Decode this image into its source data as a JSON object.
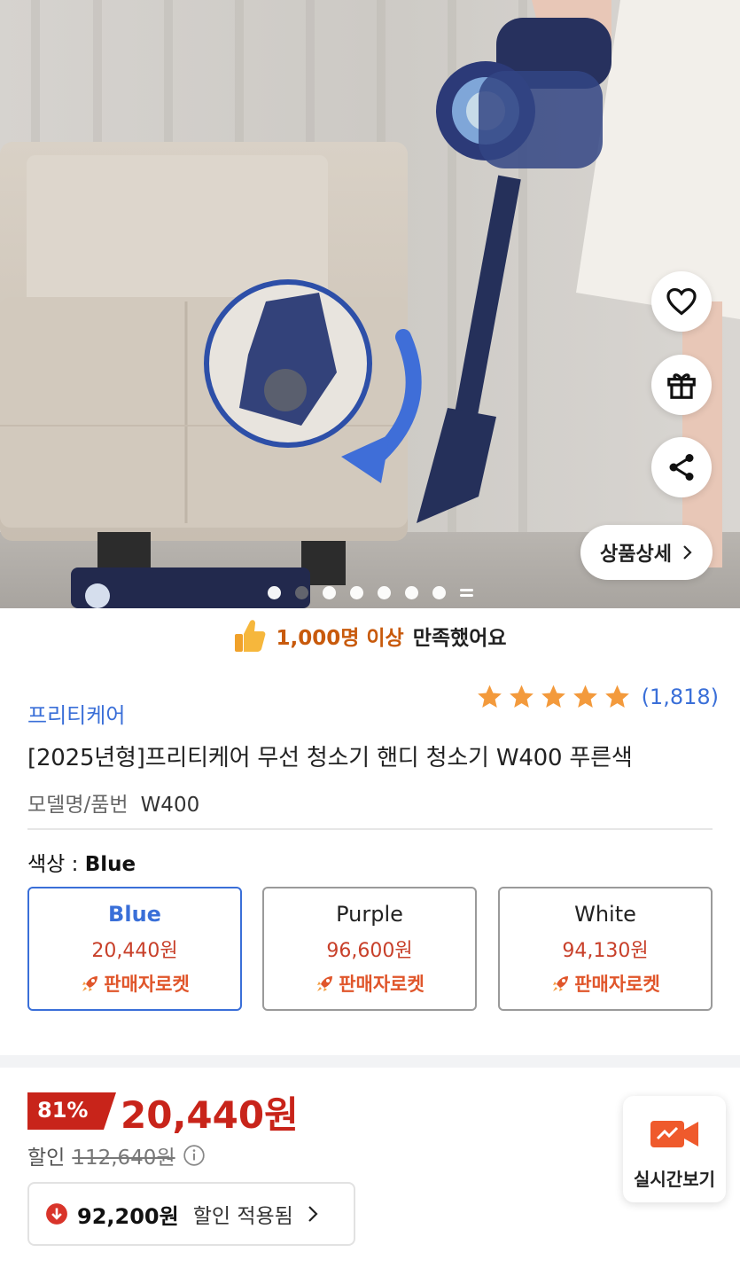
{
  "hero": {
    "detail_button": "상품상세",
    "carousel_total": 7,
    "carousel_active": 2
  },
  "satisfied": {
    "count_text": "1,000명 이상",
    "suffix": "만족했어요"
  },
  "product": {
    "brand": "프리티케어",
    "rating_stars": 5,
    "review_count": "(1,818)",
    "title": "[2025년형]프리티케어 무선 청소기 핸디 청소기 W400 푸른색",
    "model_label": "모델명/품번",
    "model_value": "W400"
  },
  "color": {
    "label": "색상 :",
    "selected": "Blue",
    "options": [
      {
        "name": "Blue",
        "price": "20,440원",
        "badge": "판매자로켓"
      },
      {
        "name": "Purple",
        "price": "96,600원",
        "badge": "판매자로켓"
      },
      {
        "name": "White",
        "price": "94,130원",
        "badge": "판매자로켓"
      }
    ]
  },
  "price": {
    "discount_rate": "81%",
    "final": "20,440원",
    "discount_label": "할인",
    "original": "112,640원",
    "coupon_amount": "92,200원",
    "coupon_label": "할인 적용됨"
  },
  "live": {
    "label": "실시간보기"
  },
  "colors": {
    "brand_blue": "#3a6fd8",
    "price_red": "#c8241a",
    "rocket_orange": "#e0562b",
    "star_orange": "#f39a3c"
  },
  "icons": [
    "heart-icon",
    "gift-icon",
    "share-icon",
    "chevron-right-icon",
    "thumbs-up-icon",
    "star-icon",
    "rocket-icon",
    "info-icon",
    "arrow-down-circle-icon",
    "live-video-icon"
  ]
}
